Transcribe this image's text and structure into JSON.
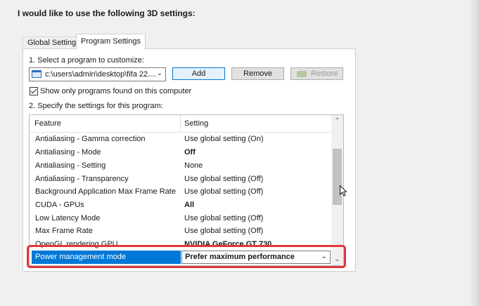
{
  "heading": "I would like to use the following 3D settings:",
  "tabs": [
    {
      "label": "Global Settings",
      "active": false
    },
    {
      "label": "Program Settings",
      "active": true
    }
  ],
  "step1": {
    "label": "1. Select a program to customize:",
    "program_value": "c:\\users\\admin\\desktop\\fifa 22....",
    "add_label": "Add",
    "remove_label": "Remove",
    "restore_label": "Restore",
    "checkbox_label": "Show only programs found on this computer",
    "checkbox_checked": true
  },
  "step2": {
    "label": "2. Specify the settings for this program:",
    "columns": [
      "Feature",
      "Setting"
    ],
    "rows": [
      {
        "feature": "Antialiasing - Gamma correction",
        "setting": "Use global setting (On)",
        "bold": false
      },
      {
        "feature": "Antialiasing - Mode",
        "setting": "Off",
        "bold": true
      },
      {
        "feature": "Antialiasing - Setting",
        "setting": "None",
        "bold": false
      },
      {
        "feature": "Antialiasing - Transparency",
        "setting": "Use global setting (Off)",
        "bold": false
      },
      {
        "feature": "Background Application Max Frame Rate",
        "setting": "Use global setting (Off)",
        "bold": false
      },
      {
        "feature": "CUDA - GPUs",
        "setting": "All",
        "bold": true
      },
      {
        "feature": "Low Latency Mode",
        "setting": "Use global setting (Off)",
        "bold": false
      },
      {
        "feature": "Max Frame Rate",
        "setting": "Use global setting (Off)",
        "bold": false
      },
      {
        "feature": "OpenGL rendering GPU",
        "setting": "NVIDIA GeForce GT 730",
        "bold": true
      }
    ],
    "selected_row": {
      "feature": "Power management mode",
      "setting": "Prefer maximum performance"
    }
  },
  "colors": {
    "selection": "#0078d7",
    "highlight_box": "#e0383c"
  }
}
